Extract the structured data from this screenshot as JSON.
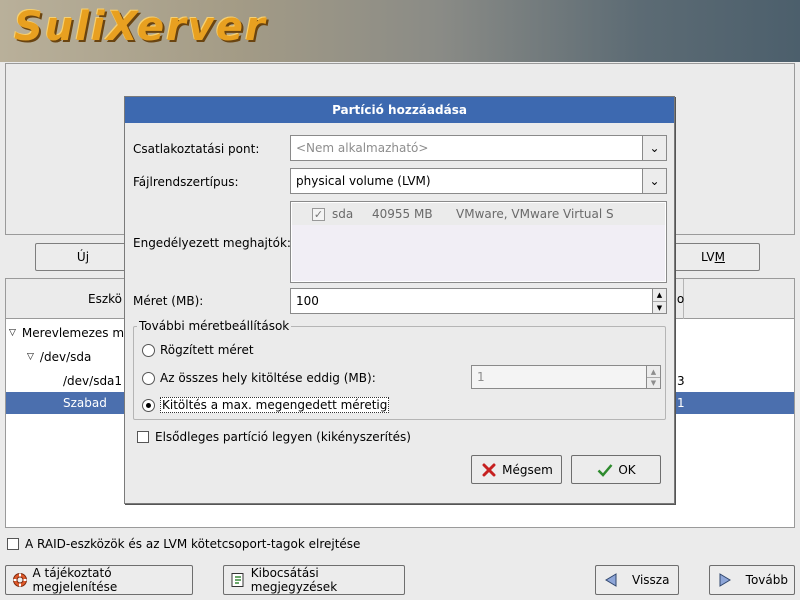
{
  "banner": {
    "logo_text": "SuliXerver"
  },
  "background": {
    "buttons": {
      "new_prefix": "Ú",
      "new_underline": "j",
      "lvm_prefix": "LV",
      "lvm_underline": "M"
    },
    "tree": {
      "header_device": "Eszkö",
      "header_right_fragment": "o",
      "rows": [
        {
          "label": "Merevlemezes m",
          "right": ""
        },
        {
          "label": "/dev/sda",
          "right": ""
        },
        {
          "label": "/dev/sda1",
          "right": "3"
        },
        {
          "label": "Szabad",
          "right": "1"
        }
      ]
    },
    "hide_raid_lvm": "A RAID-eszközök és az LVM kötetcsoport-tagok elrejtése",
    "nav": {
      "info": "A tájékoztató megjelenítése",
      "release_notes": "Kibocsátási megjegyzések",
      "back": "Vissza",
      "next": "Tovább"
    }
  },
  "dialog": {
    "title": "Partíció hozzáadása",
    "mount_point": {
      "label": "Csatlakoztatási pont:",
      "value": "<Nem alkalmazható>"
    },
    "fs_type": {
      "label": "Fájlrendszertípus:",
      "value": "physical volume (LVM)"
    },
    "drives": {
      "label": "Engedélyezett meghajtók:",
      "items": [
        {
          "name": "sda",
          "size": "40955 MB",
          "model": "VMware, VMware Virtual S",
          "checked": true
        }
      ]
    },
    "size": {
      "label": "Méret (MB):",
      "value": "100"
    },
    "size_options": {
      "legend": "További méretbeállítások",
      "fixed": "Rögzített méret",
      "fill_upto": "Az összes hely kitöltése eddig (MB):",
      "fill_upto_value": "1",
      "fill_max": "Kitöltés a max. megengedett méretig",
      "selected": "fill_max"
    },
    "primary": {
      "label": "Elsődleges partíció legyen (kikényszerítés)",
      "checked": false
    },
    "buttons": {
      "cancel": "Mégsem",
      "ok": "OK"
    }
  },
  "colors": {
    "title_bar": "#3d69b0",
    "selection": "#4b6fae",
    "logo": "#e8a020"
  }
}
